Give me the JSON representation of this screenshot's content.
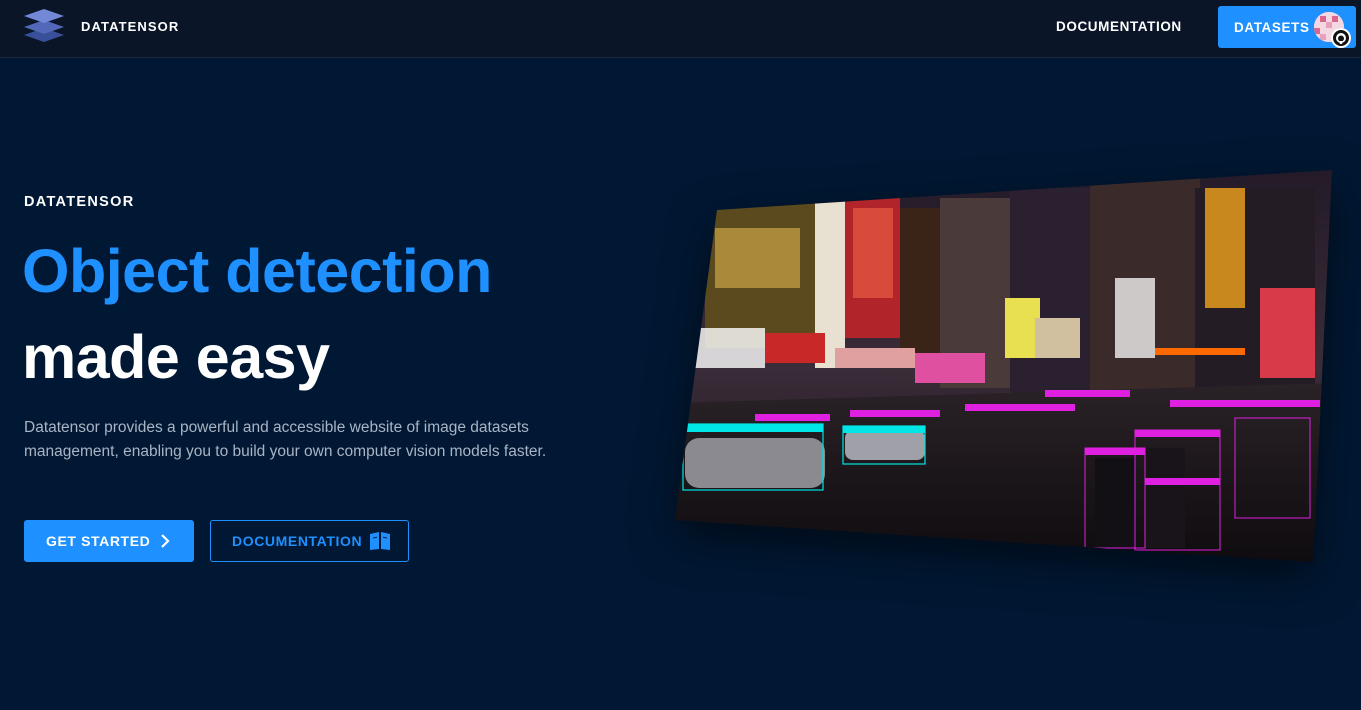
{
  "navbar": {
    "brand": "DATATENSOR",
    "documentation_label": "DOCUMENTATION",
    "datasets_label": "DATASETS"
  },
  "hero": {
    "eyebrow": "DATATENSOR",
    "headline_line1": "Object detection",
    "headline_line2": "made easy",
    "description": "Datatensor provides a powerful and accessible website of image datasets management, enabling you to build your own computer vision models faster.",
    "primary_button": "GET STARTED",
    "secondary_button": "DOCUMENTATION"
  },
  "icons": {
    "logo": "layers-logo-icon",
    "avatar": "user-avatar",
    "github": "github-icon",
    "chevron": "chevron-right-icon",
    "book": "book-open-icon"
  },
  "colors": {
    "background": "#001833",
    "navbar": "#0a1628",
    "accent": "#1e90ff",
    "muted_text": "#a9b4c4",
    "box_cyan": "#00e5e5",
    "box_magenta": "#e020e0"
  }
}
